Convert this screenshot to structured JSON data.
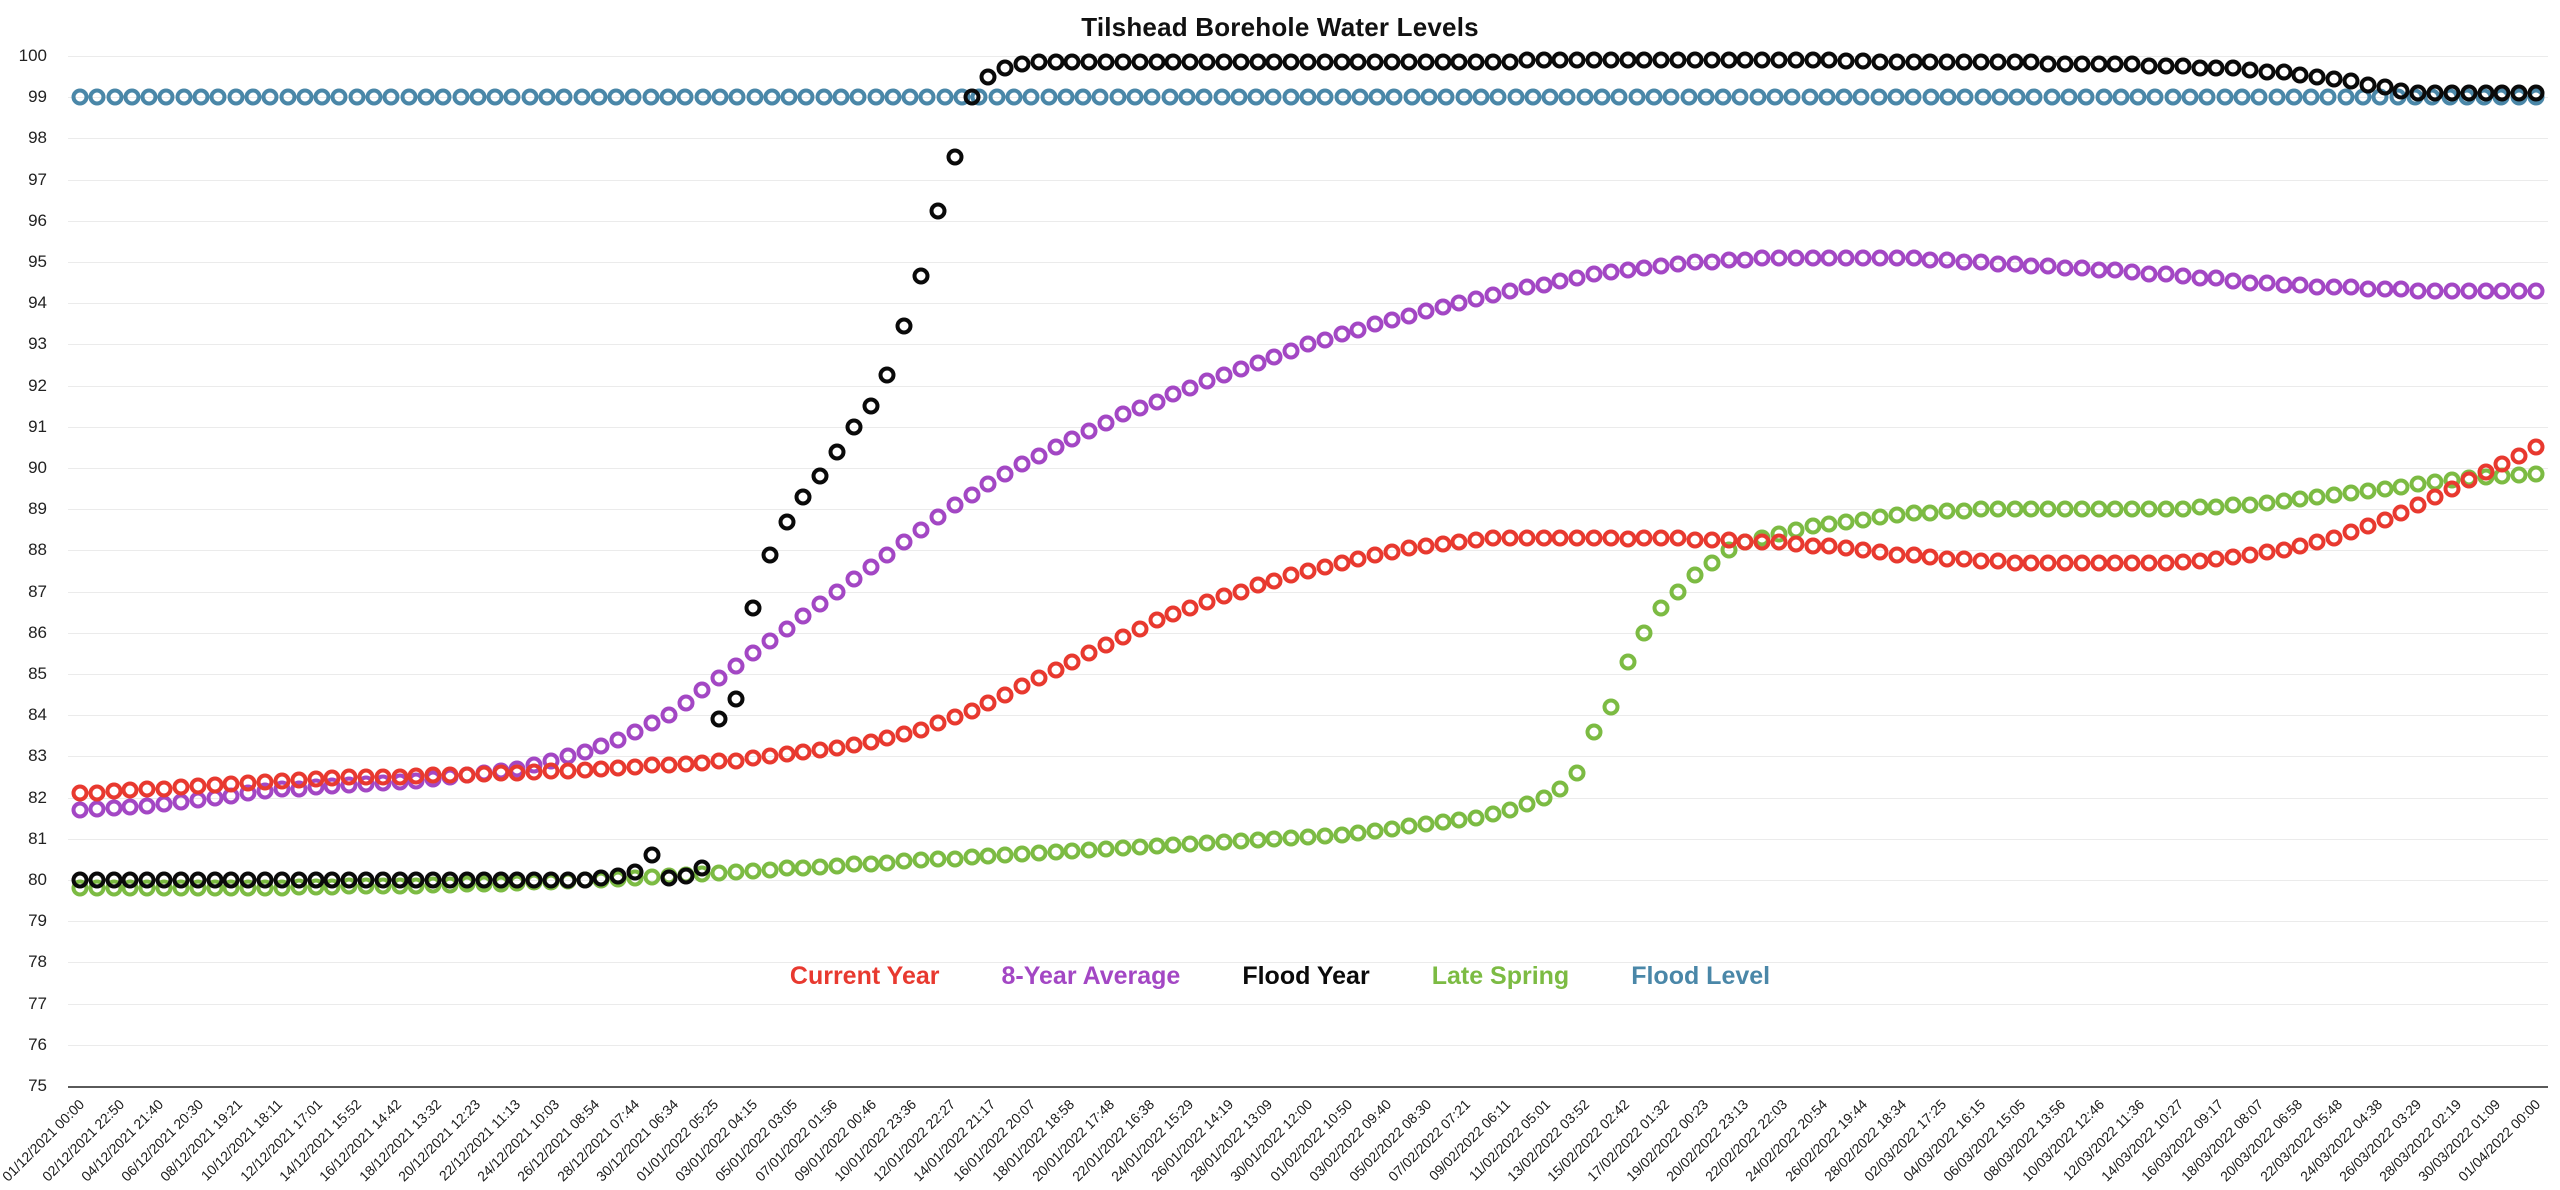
{
  "chart_data": {
    "type": "scatter",
    "title": "Tilshead Borehole Water Levels",
    "xlabel": "",
    "ylabel": "",
    "ylim": [
      75,
      100
    ],
    "ytick_labels": [
      "100",
      "99",
      "98",
      "97",
      "96",
      "95",
      "94",
      "93",
      "92",
      "91",
      "90",
      "89",
      "88",
      "87",
      "86",
      "85",
      "84",
      "83",
      "82",
      "81",
      "80",
      "79",
      "78",
      "77",
      "76",
      "75"
    ],
    "grid": true,
    "legend_position": "bottom-center",
    "marker_style": "open-circle",
    "x_start": "01/12/2021 00:00",
    "x_end": "01/04/2022 00:00",
    "x_tick_labels": [
      "01/12/2021 00:00",
      "02/12/2021 22:50",
      "04/12/2021 21:40",
      "06/12/2021 20:30",
      "08/12/2021 19:21",
      "10/12/2021 18:11",
      "12/12/2021 17:01",
      "14/12/2021 15:52",
      "16/12/2021 14:42",
      "18/12/2021 13:32",
      "20/12/2021 12:23",
      "22/12/2021 11:13",
      "24/12/2021 10:03",
      "26/12/2021 08:54",
      "28/12/2021 07:44",
      "30/12/2021 06:34",
      "01/01/2022 05:25",
      "03/01/2022 04:15",
      "05/01/2022 03:05",
      "07/01/2022 01:56",
      "09/01/2022 00:46",
      "10/01/2022 23:36",
      "12/01/2022 22:27",
      "14/01/2022 21:17",
      "16/01/2022 20:07",
      "18/01/2022 18:58",
      "20/01/2022 17:48",
      "22/01/2022 16:38",
      "24/01/2022 15:29",
      "26/01/2022 14:19",
      "28/01/2022 13:09",
      "30/01/2022 12:00",
      "01/02/2022 10:50",
      "03/02/2022 09:40",
      "05/02/2022 08:30",
      "07/02/2022 07:21",
      "09/02/2022 06:11",
      "11/02/2022 05:01",
      "13/02/2022 03:52",
      "15/02/2022 02:42",
      "17/02/2022 01:32",
      "19/02/2022 00:23",
      "20/02/2022 23:13",
      "22/02/2022 22:03",
      "24/02/2022 20:54",
      "26/02/2022 19:44",
      "28/02/2022 18:34",
      "02/03/2022 17:25",
      "04/03/2022 16:15",
      "06/03/2022 15:05",
      "08/03/2022 13:56",
      "10/03/2022 12:46",
      "12/03/2022 11:36",
      "14/03/2022 10:27",
      "16/03/2022 09:17",
      "18/03/2022 08:07",
      "20/03/2022 06:58",
      "22/03/2022 05:48",
      "24/03/2022 04:38",
      "26/03/2022 03:29",
      "28/03/2022 02:19",
      "30/03/2022 01:09",
      "01/04/2022 00:00"
    ],
    "colors": {
      "current_year": "#e8392f",
      "eight_year_average": "#a347c4",
      "flood_year": "#0a0a0a",
      "late_spring": "#7cbb43",
      "flood_level": "#4a87a8"
    },
    "series": [
      {
        "name": "Current Year",
        "color": "#e8392f",
        "values": [
          82.1,
          82.12,
          82.15,
          82.18,
          82.2,
          82.22,
          82.25,
          82.28,
          82.3,
          82.32,
          82.35,
          82.38,
          82.4,
          82.42,
          82.45,
          82.47,
          82.5,
          82.5,
          82.5,
          82.5,
          82.52,
          82.55,
          82.55,
          82.55,
          82.58,
          82.6,
          82.6,
          82.62,
          82.65,
          82.65,
          82.68,
          82.7,
          82.72,
          82.75,
          82.78,
          82.8,
          82.82,
          82.85,
          82.88,
          82.9,
          82.95,
          83.0,
          83.05,
          83.1,
          83.15,
          83.2,
          83.28,
          83.35,
          83.45,
          83.55,
          83.65,
          83.8,
          83.95,
          84.1,
          84.3,
          84.5,
          84.7,
          84.9,
          85.1,
          85.3,
          85.5,
          85.7,
          85.9,
          86.1,
          86.3,
          86.45,
          86.6,
          86.75,
          86.9,
          87.0,
          87.15,
          87.25,
          87.4,
          87.5,
          87.6,
          87.7,
          87.8,
          87.9,
          87.95,
          88.05,
          88.1,
          88.15,
          88.2,
          88.25,
          88.3,
          88.3,
          88.3,
          88.3,
          88.3,
          88.3,
          88.3,
          88.3,
          88.28,
          88.3,
          88.3,
          88.3,
          88.25,
          88.25,
          88.25,
          88.2,
          88.2,
          88.2,
          88.15,
          88.1,
          88.1,
          88.05,
          88.0,
          87.95,
          87.9,
          87.9,
          87.85,
          87.8,
          87.8,
          87.75,
          87.75,
          87.7,
          87.7,
          87.7,
          87.7,
          87.7,
          87.7,
          87.7,
          87.7,
          87.7,
          87.7,
          87.72,
          87.75,
          87.8,
          87.85,
          87.9,
          87.95,
          88.0,
          88.1,
          88.2,
          88.3,
          88.45,
          88.6,
          88.75,
          88.9,
          89.1,
          89.3,
          89.5,
          89.7,
          89.9,
          90.1,
          90.3,
          90.5
        ]
      },
      {
        "name": "8-Year Average",
        "color": "#a347c4",
        "values": [
          81.7,
          81.72,
          81.75,
          81.78,
          81.8,
          81.85,
          81.9,
          81.95,
          82.0,
          82.05,
          82.1,
          82.15,
          82.2,
          82.22,
          82.25,
          82.28,
          82.3,
          82.32,
          82.35,
          82.38,
          82.4,
          82.45,
          82.5,
          82.55,
          82.6,
          82.65,
          82.7,
          82.8,
          82.9,
          83.0,
          83.1,
          83.25,
          83.4,
          83.6,
          83.8,
          84.0,
          84.3,
          84.6,
          84.9,
          85.2,
          85.5,
          85.8,
          86.1,
          86.4,
          86.7,
          87.0,
          87.3,
          87.6,
          87.9,
          88.2,
          88.5,
          88.8,
          89.1,
          89.35,
          89.6,
          89.85,
          90.1,
          90.3,
          90.5,
          90.7,
          90.9,
          91.1,
          91.3,
          91.45,
          91.6,
          91.8,
          91.95,
          92.1,
          92.25,
          92.4,
          92.55,
          92.7,
          92.85,
          93.0,
          93.1,
          93.25,
          93.35,
          93.5,
          93.6,
          93.7,
          93.8,
          93.9,
          94.0,
          94.1,
          94.2,
          94.3,
          94.4,
          94.45,
          94.55,
          94.6,
          94.7,
          94.75,
          94.8,
          94.85,
          94.9,
          94.95,
          95.0,
          95.0,
          95.05,
          95.05,
          95.1,
          95.1,
          95.1,
          95.1,
          95.1,
          95.1,
          95.1,
          95.1,
          95.1,
          95.1,
          95.05,
          95.05,
          95.0,
          95.0,
          94.95,
          94.95,
          94.9,
          94.9,
          94.85,
          94.85,
          94.8,
          94.8,
          94.75,
          94.7,
          94.7,
          94.65,
          94.6,
          94.6,
          94.55,
          94.5,
          94.5,
          94.45,
          94.45,
          94.4,
          94.4,
          94.4,
          94.35,
          94.35,
          94.35,
          94.3,
          94.3,
          94.3,
          94.3,
          94.3,
          94.3,
          94.3,
          94.3
        ]
      },
      {
        "name": "Flood Year",
        "color": "#0a0a0a",
        "values": [
          80.0,
          80.0,
          80.0,
          80.0,
          80.0,
          80.0,
          80.0,
          80.0,
          80.0,
          80.0,
          80.0,
          80.0,
          80.0,
          80.0,
          80.0,
          80.0,
          80.0,
          80.0,
          80.0,
          80.0,
          80.0,
          80.0,
          80.0,
          80.0,
          80.0,
          80.0,
          80.0,
          80.0,
          80.0,
          80.0,
          80.0,
          80.05,
          80.1,
          80.2,
          80.6,
          80.05,
          80.1,
          80.3,
          83.9,
          84.4,
          86.6,
          87.9,
          88.7,
          89.3,
          89.8,
          90.4,
          91.0,
          91.5,
          92.25,
          93.45,
          94.65,
          96.25,
          97.55,
          99.0,
          99.5,
          99.7,
          99.8,
          99.85,
          99.85,
          99.85,
          99.85,
          99.85,
          99.85,
          99.85,
          99.85,
          99.85,
          99.85,
          99.85,
          99.85,
          99.85,
          99.85,
          99.85,
          99.85,
          99.85,
          99.85,
          99.85,
          99.85,
          99.85,
          99.85,
          99.85,
          99.85,
          99.85,
          99.85,
          99.85,
          99.85,
          99.85,
          99.9,
          99.9,
          99.9,
          99.9,
          99.9,
          99.9,
          99.9,
          99.9,
          99.9,
          99.9,
          99.9,
          99.9,
          99.9,
          99.9,
          99.9,
          99.9,
          99.9,
          99.9,
          99.9,
          99.88,
          99.88,
          99.85,
          99.85,
          99.85,
          99.85,
          99.85,
          99.85,
          99.85,
          99.85,
          99.85,
          99.85,
          99.8,
          99.8,
          99.8,
          99.8,
          99.8,
          99.8,
          99.75,
          99.75,
          99.75,
          99.7,
          99.7,
          99.7,
          99.65,
          99.6,
          99.6,
          99.55,
          99.5,
          99.45,
          99.4,
          99.3,
          99.25,
          99.15,
          99.1,
          99.1,
          99.1,
          99.1,
          99.1,
          99.1,
          99.1,
          99.1
        ]
      },
      {
        "name": "Late Spring",
        "color": "#7cbb43",
        "values": [
          79.8,
          79.8,
          79.8,
          79.8,
          79.8,
          79.8,
          79.8,
          79.8,
          79.8,
          79.8,
          79.8,
          79.8,
          79.8,
          79.82,
          79.82,
          79.82,
          79.85,
          79.85,
          79.85,
          79.85,
          79.85,
          79.88,
          79.88,
          79.9,
          79.9,
          79.9,
          79.92,
          79.95,
          79.95,
          79.98,
          80.0,
          80.0,
          80.02,
          80.05,
          80.08,
          80.1,
          80.12,
          80.15,
          80.18,
          80.2,
          80.22,
          80.25,
          80.28,
          80.3,
          80.32,
          80.35,
          80.38,
          80.4,
          80.42,
          80.45,
          80.48,
          80.5,
          80.52,
          80.55,
          80.58,
          80.6,
          80.62,
          80.65,
          80.68,
          80.7,
          80.72,
          80.75,
          80.78,
          80.8,
          80.82,
          80.85,
          80.88,
          80.9,
          80.92,
          80.95,
          80.98,
          81.0,
          81.02,
          81.05,
          81.08,
          81.1,
          81.15,
          81.2,
          81.25,
          81.3,
          81.35,
          81.4,
          81.45,
          81.5,
          81.6,
          81.7,
          81.85,
          82.0,
          82.2,
          82.6,
          83.6,
          84.2,
          85.3,
          86.0,
          86.6,
          87.0,
          87.4,
          87.7,
          88.0,
          88.2,
          88.3,
          88.4,
          88.5,
          88.6,
          88.65,
          88.7,
          88.75,
          88.8,
          88.85,
          88.9,
          88.9,
          88.95,
          88.95,
          89.0,
          89.0,
          89.0,
          89.0,
          89.0,
          89.0,
          89.0,
          89.0,
          89.0,
          89.0,
          89.0,
          89.0,
          89.0,
          89.05,
          89.05,
          89.1,
          89.1,
          89.15,
          89.2,
          89.25,
          89.3,
          89.35,
          89.4,
          89.45,
          89.5,
          89.55,
          89.6,
          89.65,
          89.7,
          89.75,
          89.78,
          89.8,
          89.82,
          89.85
        ]
      },
      {
        "name": "Flood Level",
        "color": "#4a87a8",
        "constant_value": 99.0,
        "values": [
          99,
          99,
          99,
          99,
          99,
          99,
          99,
          99,
          99,
          99,
          99,
          99,
          99,
          99,
          99,
          99,
          99,
          99,
          99,
          99,
          99,
          99,
          99,
          99,
          99,
          99,
          99,
          99,
          99,
          99,
          99,
          99,
          99,
          99,
          99,
          99,
          99,
          99,
          99,
          99,
          99,
          99,
          99,
          99,
          99,
          99,
          99,
          99,
          99,
          99,
          99,
          99,
          99,
          99,
          99,
          99,
          99,
          99,
          99,
          99,
          99,
          99,
          99,
          99,
          99,
          99,
          99,
          99,
          99,
          99,
          99,
          99,
          99,
          99,
          99,
          99,
          99,
          99,
          99,
          99,
          99,
          99,
          99,
          99,
          99,
          99,
          99,
          99,
          99,
          99,
          99,
          99,
          99,
          99,
          99,
          99,
          99,
          99,
          99,
          99,
          99,
          99,
          99,
          99,
          99,
          99,
          99,
          99,
          99,
          99,
          99,
          99,
          99,
          99,
          99,
          99,
          99,
          99,
          99,
          99,
          99,
          99,
          99,
          99,
          99,
          99,
          99,
          99,
          99,
          99,
          99,
          99,
          99,
          99,
          99,
          99,
          99,
          99,
          99,
          99,
          99,
          99,
          99
        ]
      }
    ]
  },
  "legend": {
    "items": [
      {
        "label": "Current Year",
        "color": "#e8392f"
      },
      {
        "label": "8-Year Average",
        "color": "#a347c4"
      },
      {
        "label": "Flood Year",
        "color": "#0a0a0a"
      },
      {
        "label": "Late Spring",
        "color": "#7cbb43"
      },
      {
        "label": "Flood Level",
        "color": "#4a87a8"
      }
    ]
  }
}
